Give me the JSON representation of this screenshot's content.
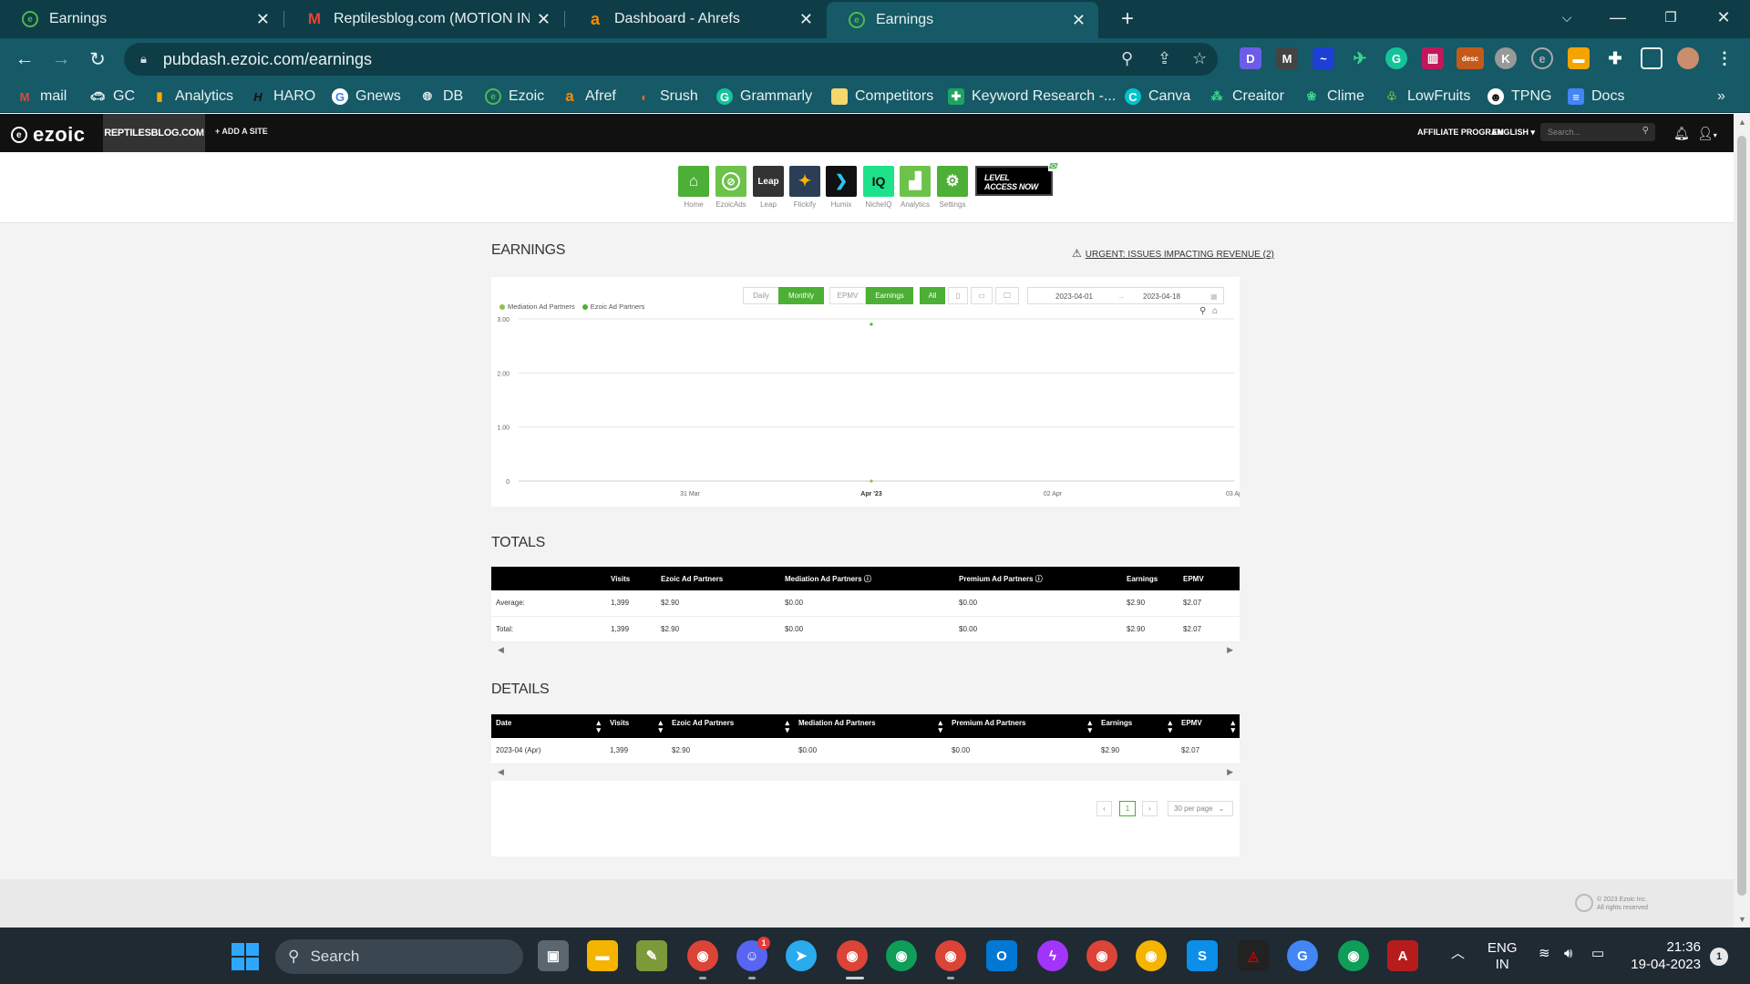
{
  "browser": {
    "tabs": [
      {
        "title": "Earnings"
      },
      {
        "title": "Reptilesblog.com (MOTION INVE"
      },
      {
        "title": "Dashboard - Ahrefs"
      },
      {
        "title": "Earnings"
      }
    ],
    "new_tab": "+",
    "url": "pubdash.ezoic.com/earnings",
    "ext_labels": {
      "d": "D",
      "m": "M",
      "k": "K",
      "desc": "desc"
    },
    "bookmarks": [
      "mail",
      "GC",
      "Analytics",
      "HARO",
      "Gnews",
      "DB",
      "Ezoic",
      "Afref",
      "Srush",
      "Grammarly",
      "Competitors",
      "Keyword Research -...",
      "Canva",
      "Creaitor",
      "Clime",
      "LowFruits",
      "TPNG",
      "Docs"
    ],
    "bookmark_more": "»"
  },
  "ezoic": {
    "brand": "ezoic",
    "site": "REPTILESBLOG.COM",
    "add_site": "+ ADD A SITE",
    "affiliate": "AFFILIATE PROGRAM",
    "language": "ENGLISH",
    "search_placeholder": "Search...",
    "apps": [
      {
        "label": "Home"
      },
      {
        "label": "EzoicAds"
      },
      {
        "label": "Leap",
        "text": "Leap"
      },
      {
        "label": "Flickify"
      },
      {
        "label": "Humix"
      },
      {
        "label": "NicheIQ",
        "text": "IQ"
      },
      {
        "label": "Analytics"
      },
      {
        "label": "Settings"
      }
    ],
    "level_banner": [
      "LEVEL",
      "ACCESS NOW"
    ]
  },
  "earnings": {
    "title": "EARNINGS",
    "urgent": "URGENT: ISSUES IMPACTING REVENUE (2)",
    "controls": {
      "daily": "Daily",
      "monthly": "Monthly",
      "epmv": "EPMV",
      "earnings": "Earnings",
      "all": "All",
      "date_from": "2023-04-01",
      "date_to": "2023-04-18"
    }
  },
  "chart_data": {
    "type": "line",
    "legend": [
      "Mediation Ad Partners",
      "Ezoic Ad Partners"
    ],
    "y_ticks": [
      "3.00",
      "2.00",
      "1.00",
      "0"
    ],
    "ylim": [
      0,
      3
    ],
    "x_ticks": [
      "31 Mar",
      "Apr '23",
      "02 Apr",
      "03 Ap"
    ],
    "series": [
      {
        "name": "Ezoic Ad Partners",
        "color": "#4caf36",
        "points": [
          {
            "x": "Apr '23",
            "y": 2.9
          }
        ]
      },
      {
        "name": "Mediation Ad Partners",
        "color": "#8bc34a",
        "points": [
          {
            "x": "Apr '23",
            "y": 0
          }
        ]
      }
    ]
  },
  "totals": {
    "title": "TOTALS",
    "headers": [
      "",
      "Visits",
      "Ezoic Ad Partners",
      "Mediation Ad Partners",
      "Premium Ad Partners",
      "Earnings",
      "EPMV"
    ],
    "rows": [
      [
        "Average:",
        "1,399",
        "$2.90",
        "$0.00",
        "$0.00",
        "$2.90",
        "$2.07"
      ],
      [
        "Total:",
        "1,399",
        "$2.90",
        "$0.00",
        "$0.00",
        "$2.90",
        "$2.07"
      ]
    ]
  },
  "details": {
    "title": "DETAILS",
    "headers": [
      "Date",
      "Visits",
      "Ezoic Ad Partners",
      "Mediation Ad Partners",
      "Premium Ad Partners",
      "Earnings",
      "EPMV"
    ],
    "rows": [
      [
        "2023-04 (Apr)",
        "1,399",
        "$2.90",
        "$0.00",
        "$0.00",
        "$2.90",
        "$2.07"
      ]
    ],
    "page": "1",
    "per_page": "30 per page"
  },
  "footer": {
    "line1": "© 2023 Ezoic Inc.",
    "line2": "All rights reserved"
  },
  "taskbar": {
    "search": "Search",
    "discord_badge": "1",
    "lang": "ENG",
    "region": "IN",
    "time": "21:36",
    "date": "19-04-2023",
    "notifications": "1"
  }
}
